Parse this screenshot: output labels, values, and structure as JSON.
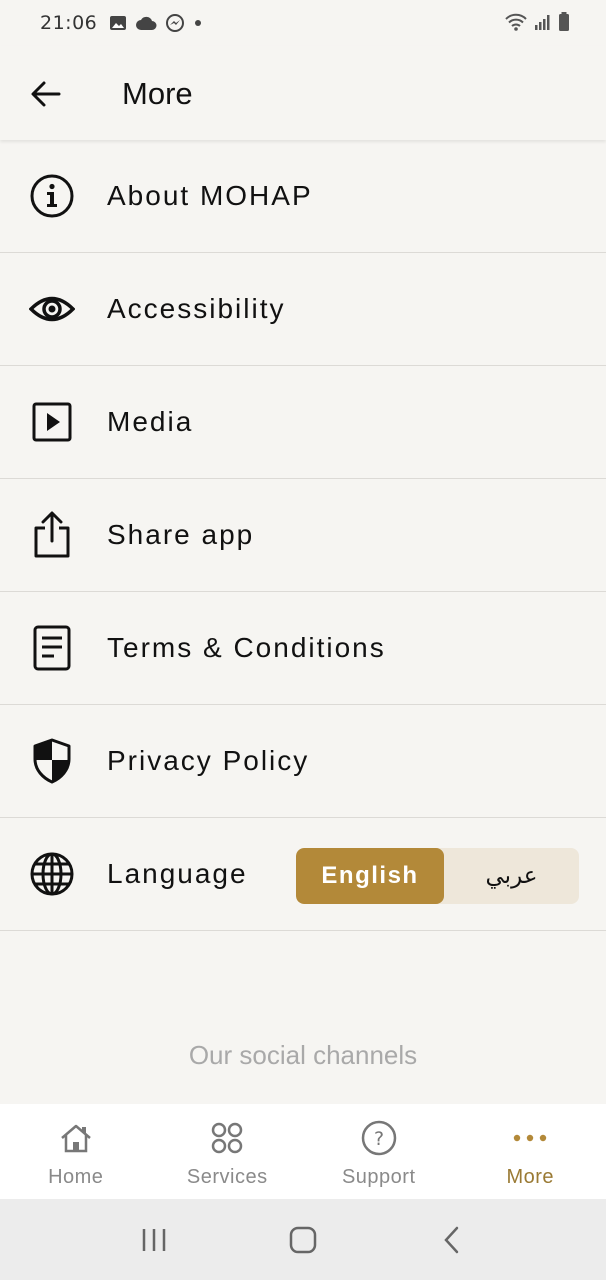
{
  "status_bar": {
    "time": "21:06",
    "left_icons": [
      "image-icon",
      "cloud-icon",
      "messenger-icon",
      "dot-icon"
    ],
    "right_icons": [
      "wifi-icon",
      "signal-icon",
      "battery-icon"
    ]
  },
  "app_bar": {
    "title": "More",
    "back_icon": "arrow-left-icon"
  },
  "menu": {
    "items": [
      {
        "label": "About MOHAP",
        "icon": "info-icon"
      },
      {
        "label": "Accessibility",
        "icon": "eye-icon"
      },
      {
        "label": "Media",
        "icon": "play-icon"
      },
      {
        "label": "Share app",
        "icon": "share-icon"
      },
      {
        "label": "Terms & Conditions",
        "icon": "document-icon"
      },
      {
        "label": "Privacy Policy",
        "icon": "shield-icon"
      },
      {
        "label": "Language",
        "icon": "globe-icon"
      }
    ]
  },
  "language_toggle": {
    "active": "English",
    "inactive": "عربي"
  },
  "social": {
    "title": "Our social channels"
  },
  "bottom_nav": {
    "items": [
      {
        "label": "Home",
        "icon": "home-icon"
      },
      {
        "label": "Services",
        "icon": "grid-icon"
      },
      {
        "label": "Support",
        "icon": "help-icon"
      },
      {
        "label": "More",
        "icon": "more-dots-icon"
      }
    ],
    "active": "More"
  },
  "colors": {
    "accent": "#b38939",
    "accent_text": "#9a7a34",
    "background": "#f6f5f2",
    "toggle_bg": "#eee7da"
  }
}
